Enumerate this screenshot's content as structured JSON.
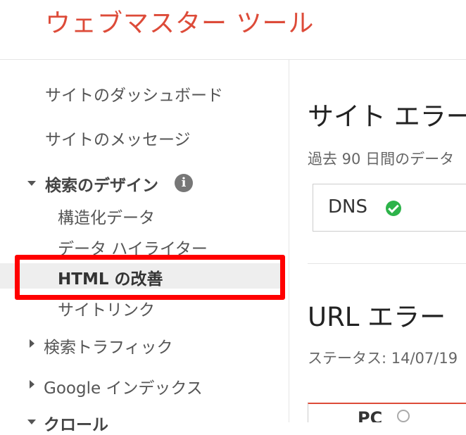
{
  "header": {
    "title": "ウェブマスター ツール"
  },
  "sidebar": {
    "items": [
      {
        "label": "サイトのダッシュボード"
      },
      {
        "label": "サイトのメッセージ"
      }
    ],
    "search_design": {
      "label": "検索のデザイン",
      "info_icon": "i",
      "expanded": true,
      "children": [
        {
          "label": "構造化データ"
        },
        {
          "label": "データ ハイライター"
        },
        {
          "label": "HTML の改善",
          "selected": true
        },
        {
          "label": "サイトリンク"
        }
      ]
    },
    "search_traffic": {
      "label": "検索トラフィック"
    },
    "google_index": {
      "label": "Google インデックス"
    },
    "crawl": {
      "label": "クロール"
    }
  },
  "main": {
    "site_errors": {
      "title": "サイト エラー",
      "subtitle": "過去 90 日間のデータ",
      "dns_label": "DNS",
      "dns_status_icon": "check-circle-icon"
    },
    "url_errors": {
      "title": "URL エラー",
      "status_text": "ステータス: 14/07/19",
      "tab_label": "PC"
    }
  },
  "colors": {
    "brand": "#dd4b39",
    "highlight": "#ff0000",
    "ok": "#2db34a"
  }
}
